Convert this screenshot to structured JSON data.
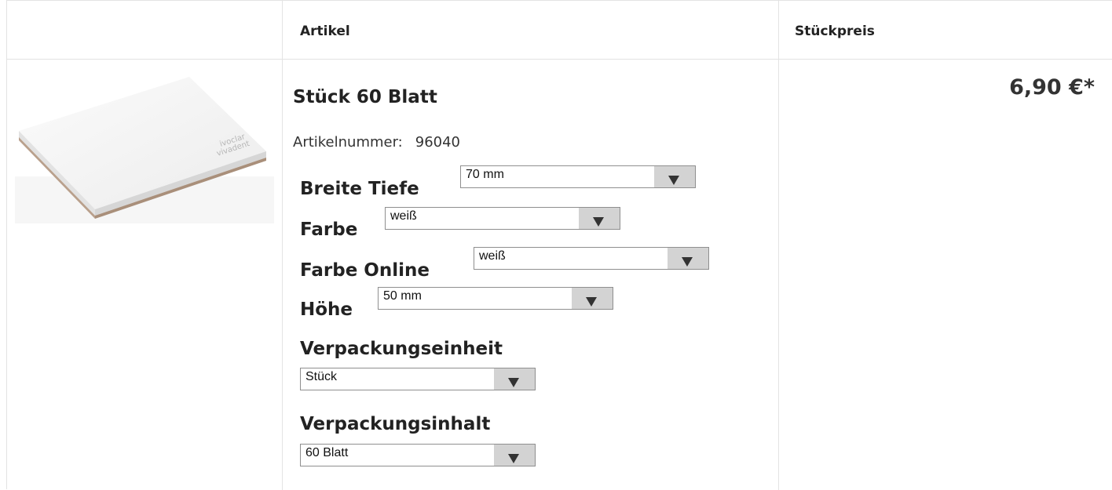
{
  "header": {
    "col_article": "Artikel",
    "col_price": "Stückpreis"
  },
  "product": {
    "image_icon": "product-box-image",
    "name": "Stück 60 Blatt",
    "article_number_label": "Artikelnummer:",
    "article_number": "96040",
    "price": "6,90 €*",
    "options": {
      "breite_tiefe": {
        "label": "Breite Tiefe",
        "value": "70 mm"
      },
      "farbe": {
        "label": "Farbe",
        "value": "weiß"
      },
      "farbe_online": {
        "label": "Farbe Online",
        "value": "weiß"
      },
      "hoehe": {
        "label": "Höhe",
        "value": "50 mm"
      },
      "verpackungseinheit": {
        "label": "Verpackungseinheit",
        "value": "Stück"
      },
      "verpackungsinhalt": {
        "label": "Verpackungsinhalt",
        "value": "60 Blatt"
      }
    }
  }
}
